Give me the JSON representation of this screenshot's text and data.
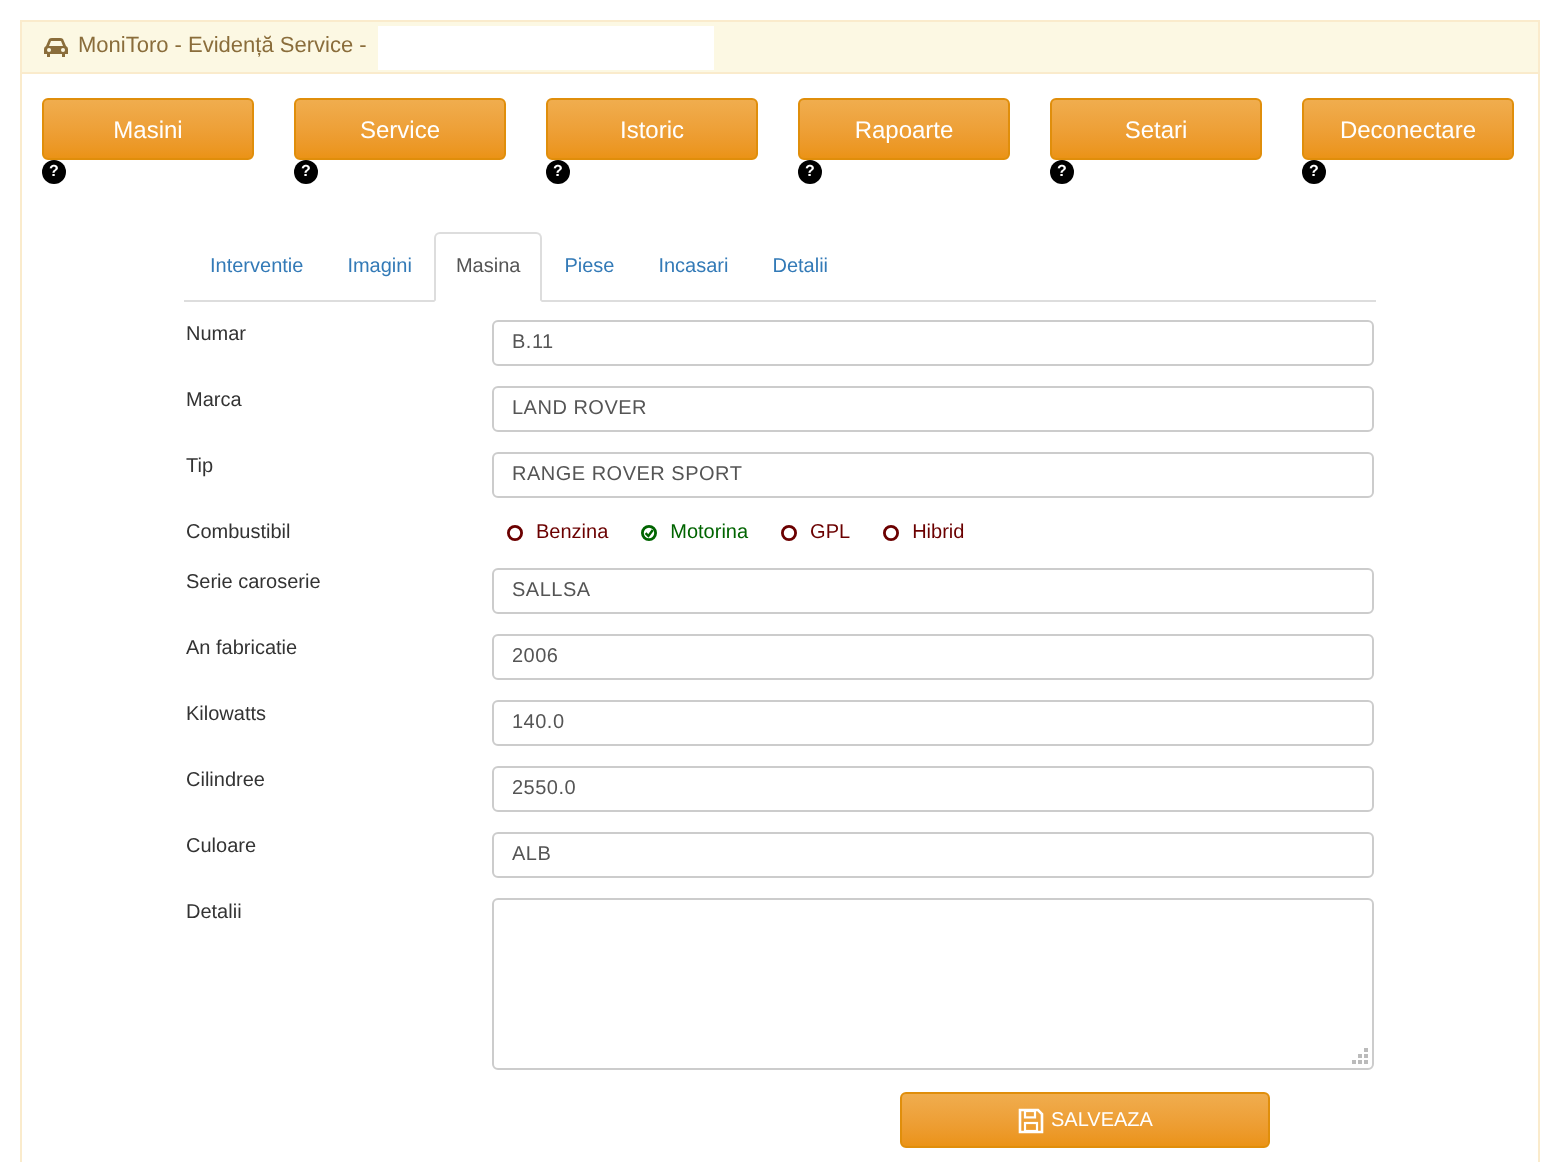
{
  "window": {
    "title": "MoniToro - Evidență Service -"
  },
  "nav_buttons": [
    {
      "label": "Masini",
      "help": "?"
    },
    {
      "label": "Service",
      "help": "?"
    },
    {
      "label": "Istoric",
      "help": "?"
    },
    {
      "label": "Rapoarte",
      "help": "?"
    },
    {
      "label": "Setari",
      "help": "?"
    },
    {
      "label": "Deconectare",
      "help": "?"
    }
  ],
  "tabs": [
    {
      "label": "Interventie",
      "selected": false
    },
    {
      "label": "Imagini",
      "selected": false
    },
    {
      "label": "Masina",
      "selected": true
    },
    {
      "label": "Piese",
      "selected": false
    },
    {
      "label": "Incasari",
      "selected": false
    },
    {
      "label": "Detalii",
      "selected": false
    }
  ],
  "form": [
    {
      "kind": "text",
      "label": "Numar",
      "value": "B.11"
    },
    {
      "kind": "text",
      "label": "Marca",
      "value": "LAND ROVER"
    },
    {
      "kind": "text",
      "label": "Tip",
      "value": "RANGE ROVER SPORT"
    },
    {
      "kind": "radio",
      "label": "Combustibil",
      "options": [
        {
          "label": "Benzina",
          "selected": false
        },
        {
          "label": "Motorina",
          "selected": true
        },
        {
          "label": "GPL",
          "selected": false
        },
        {
          "label": "Hibrid",
          "selected": false
        }
      ]
    },
    {
      "kind": "text",
      "label": "Serie caroserie",
      "value": "SALLSA"
    },
    {
      "kind": "text",
      "label": "An fabricatie",
      "value": "2006"
    },
    {
      "kind": "text",
      "label": "Kilowatts",
      "value": "140.0"
    },
    {
      "kind": "text",
      "label": "Cilindree",
      "value": "2550.0"
    },
    {
      "kind": "text",
      "label": "Culoare",
      "value": "ALB"
    },
    {
      "kind": "textarea",
      "label": "Detalii"
    }
  ],
  "save_button": {
    "label": "SALVEAZA"
  }
}
